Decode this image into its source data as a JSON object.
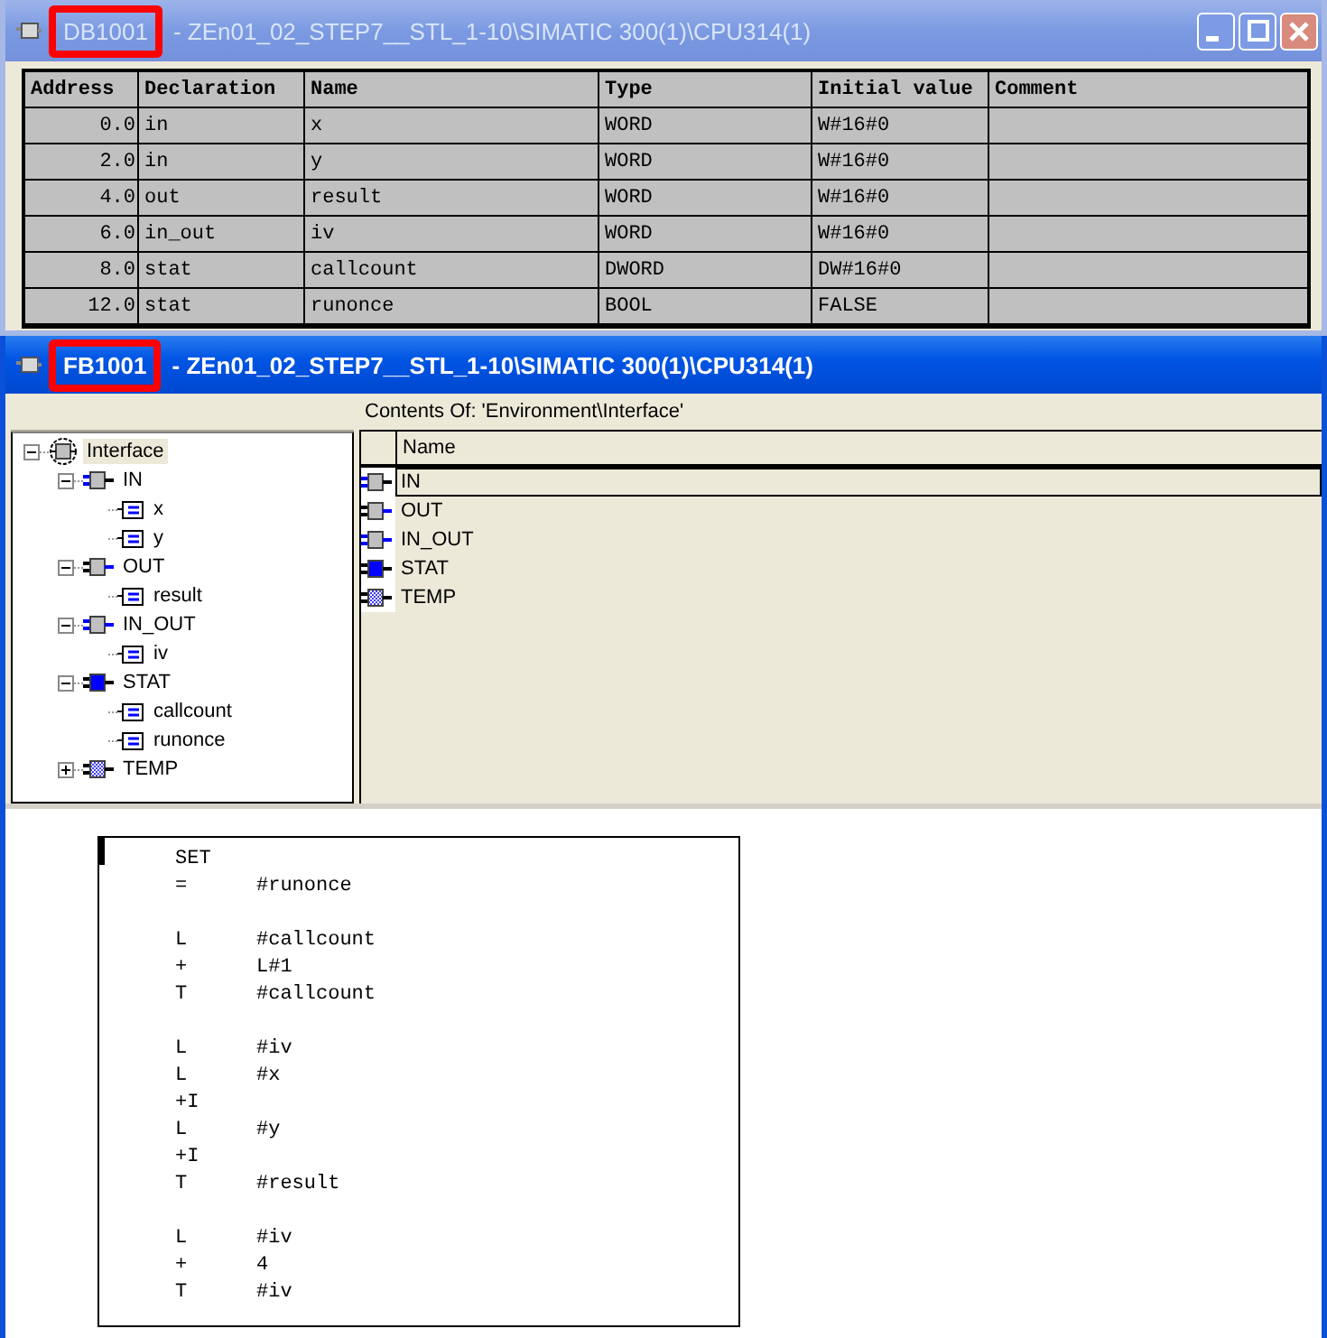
{
  "db_window": {
    "block": "DB1001",
    "marked": true,
    "path": "- ZEn01_02_STEP7__STL_1-10\\SIMATIC 300(1)\\CPU314(1)",
    "active": false,
    "buttons": [
      {
        "kind": "minimize"
      },
      {
        "kind": "maximize"
      },
      {
        "kind": "close"
      }
    ],
    "table": {
      "columns": [
        "Address",
        "Declaration",
        "Name",
        "Type",
        "Initial value",
        "Comment"
      ],
      "rows": [
        {
          "address": "0.0",
          "declaration": "in",
          "name": "x",
          "type": "WORD",
          "initial_value": "W#16#0"
        },
        {
          "address": "2.0",
          "declaration": "in",
          "name": "y",
          "type": "WORD",
          "initial_value": "W#16#0"
        },
        {
          "address": "4.0",
          "declaration": "out",
          "name": "result",
          "type": "WORD",
          "initial_value": "W#16#0"
        },
        {
          "address": "6.0",
          "declaration": "in_out",
          "name": "iv",
          "type": "WORD",
          "initial_value": "W#16#0"
        },
        {
          "address": "8.0",
          "declaration": "stat",
          "name": "callcount",
          "type": "DWORD",
          "initial_value": "DW#16#0"
        },
        {
          "address": "12.0",
          "declaration": "stat",
          "name": "runonce",
          "type": "BOOL",
          "initial_value": "FALSE"
        }
      ]
    }
  },
  "fb_window": {
    "block": "FB1001",
    "marked": true,
    "path": "- ZEn01_02_STEP7__STL_1-10\\SIMATIC 300(1)\\CPU314(1)",
    "active": true,
    "tree": [
      {
        "label": "Interface",
        "kind": "interface",
        "selected": true,
        "expanded": true,
        "children": [
          {
            "label": "IN",
            "kind": "in",
            "selected": false,
            "expanded": true,
            "children": [
              {
                "label": "x",
                "kind": "variable",
                "selected": false
              },
              {
                "label": "y",
                "kind": "variable",
                "selected": false
              }
            ]
          },
          {
            "label": "OUT",
            "kind": "out",
            "selected": false,
            "expanded": true,
            "children": [
              {
                "label": "result",
                "kind": "variable",
                "selected": false
              }
            ]
          },
          {
            "label": "IN_OUT",
            "kind": "in_out",
            "selected": false,
            "expanded": true,
            "children": [
              {
                "label": "iv",
                "kind": "variable",
                "selected": false
              }
            ]
          },
          {
            "label": "STAT",
            "kind": "stat",
            "selected": false,
            "expanded": true,
            "children": [
              {
                "label": "callcount",
                "kind": "variable",
                "selected": false
              },
              {
                "label": "runonce",
                "kind": "variable",
                "selected": false
              }
            ]
          },
          {
            "label": "TEMP",
            "kind": "temp",
            "selected": false,
            "expanded": false
          }
        ]
      }
    ],
    "contents": {
      "title": "Contents Of: 'Environment\\Interface'",
      "column": "Name",
      "items": [
        {
          "label": "IN",
          "kind": "in",
          "selected": true
        },
        {
          "label": "OUT",
          "kind": "out",
          "selected": false
        },
        {
          "label": "IN_OUT",
          "kind": "in_out",
          "selected": false
        },
        {
          "label": "STAT",
          "kind": "stat",
          "selected": false
        },
        {
          "label": "TEMP",
          "kind": "temp",
          "selected": false
        }
      ]
    },
    "code": {
      "groups": [
        {
          "lines": [
            {
              "op": "SET"
            },
            {
              "op": "=",
              "operand": "#runonce"
            }
          ]
        },
        {
          "lines": [
            {
              "op": "L",
              "operand": "#callcount"
            },
            {
              "op": "+",
              "operand": "L#1"
            },
            {
              "op": "T",
              "operand": "#callcount"
            }
          ]
        },
        {
          "lines": [
            {
              "op": "L",
              "operand": "#iv"
            },
            {
              "op": "L",
              "operand": "#x"
            },
            {
              "op": "+I"
            },
            {
              "op": "L",
              "operand": "#y"
            },
            {
              "op": "+I"
            },
            {
              "op": "T",
              "operand": "#result"
            }
          ]
        },
        {
          "lines": [
            {
              "op": "L",
              "operand": "#iv"
            },
            {
              "op": "+",
              "operand": "4"
            },
            {
              "op": "T",
              "operand": "#iv"
            }
          ]
        }
      ]
    }
  }
}
